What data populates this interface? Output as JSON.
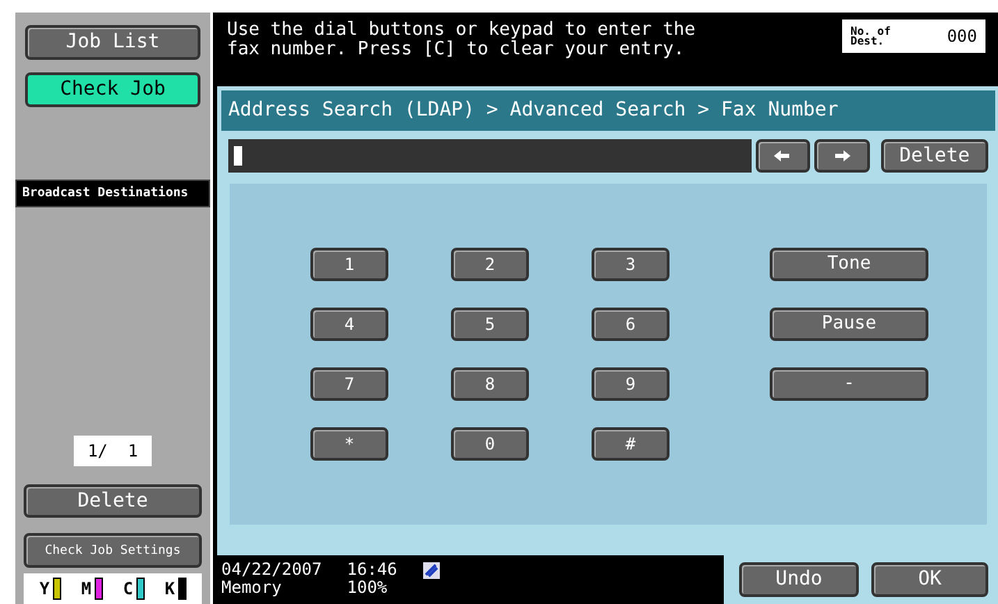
{
  "sidebar": {
    "job_list": "Job List",
    "check_job": {
      "label": "Check Job",
      "selected": true
    },
    "section_title": "Broadcast Destinations",
    "page_counter": "1/  1",
    "delete": "Delete",
    "check_job_settings": "Check Job Settings",
    "toners": [
      {
        "label": "Y",
        "color": "#c8c400"
      },
      {
        "label": "M",
        "color": "#e020e0"
      },
      {
        "label": "C",
        "color": "#30c8c8"
      },
      {
        "label": "K",
        "color": "#000000"
      }
    ]
  },
  "message": "Use the dial buttons or keypad to enter the fax number. Press [C] to clear your entry.",
  "destinations": {
    "label": "No. of Dest.",
    "count": "000"
  },
  "breadcrumb": "Address Search (LDAP) > Advanced Search > Fax Number",
  "entry_buttons": [
    {
      "kind": "left"
    },
    {
      "kind": "right"
    }
  ],
  "delete": "Delete",
  "keypad": [
    [
      "1",
      "2",
      "3"
    ],
    [
      "4",
      "5",
      "6"
    ],
    [
      "7",
      "8",
      "9"
    ],
    [
      "*",
      "0",
      "#"
    ]
  ],
  "function_keys": [
    "Tone",
    "Pause",
    "-"
  ],
  "status": {
    "date": "04/22/2007",
    "time": "16:46",
    "memory_label": "Memory",
    "memory": "100%"
  },
  "undo": "Undo",
  "ok": "OK"
}
